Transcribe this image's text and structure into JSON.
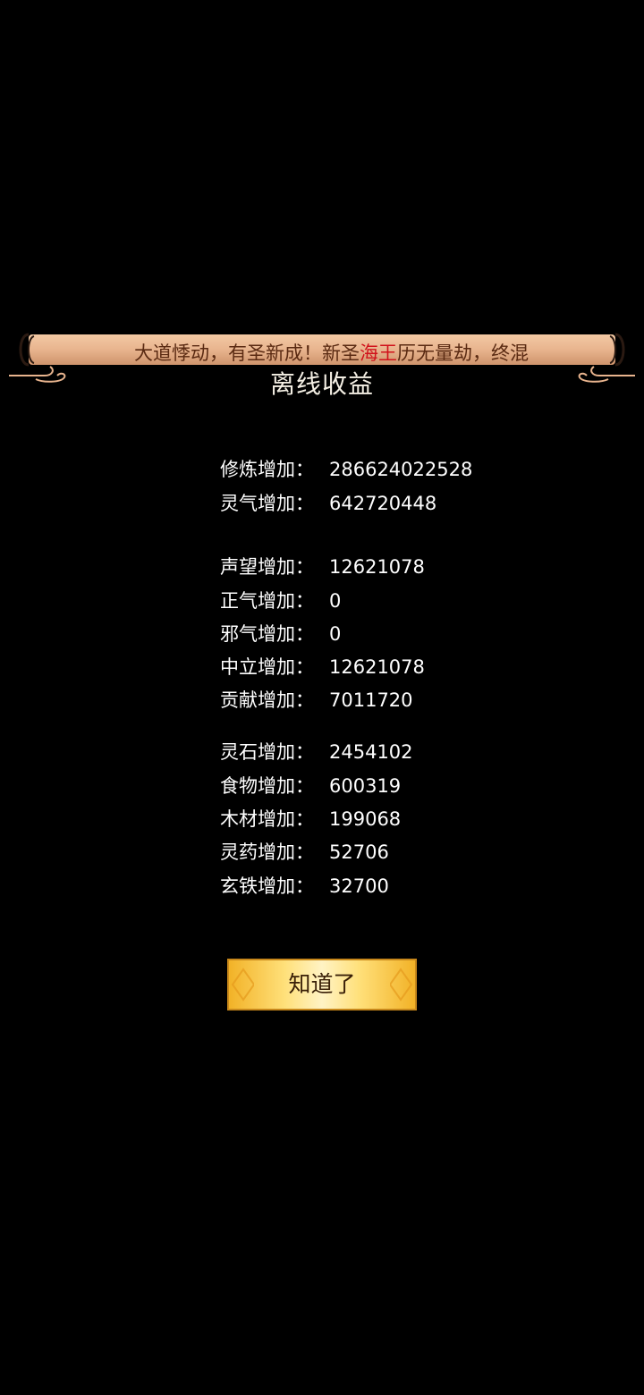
{
  "banner": {
    "text_before": "大道悸动，有圣新成！新圣",
    "text_highlight": "海王",
    "text_after": "历无量劫，终混",
    "highlight_color": "#d0121b",
    "text_color": "#5a2a12"
  },
  "dialog": {
    "title": "离线收益",
    "rows": [
      {
        "label": "修炼增加：",
        "value": "286624022528"
      },
      {
        "label": "灵气增加：",
        "value": "642720448"
      },
      {
        "label": "声望增加：",
        "value": "12621078"
      },
      {
        "label": "正气增加：",
        "value": "0"
      },
      {
        "label": "邪气增加：",
        "value": "0"
      },
      {
        "label": "中立增加：",
        "value": "12621078"
      },
      {
        "label": "贡献增加：",
        "value": "7011720"
      },
      {
        "label": "灵石增加：",
        "value": "2454102"
      },
      {
        "label": "食物增加：",
        "value": "600319"
      },
      {
        "label": "木材增加：",
        "value": "199068"
      },
      {
        "label": "灵药增加：",
        "value": "52706"
      },
      {
        "label": "玄铁增加：",
        "value": "32700"
      }
    ],
    "confirm_label": "知道了"
  },
  "colors": {
    "background": "#000000",
    "scroll": "#e8b48e",
    "button_gold": "#f2b227"
  }
}
